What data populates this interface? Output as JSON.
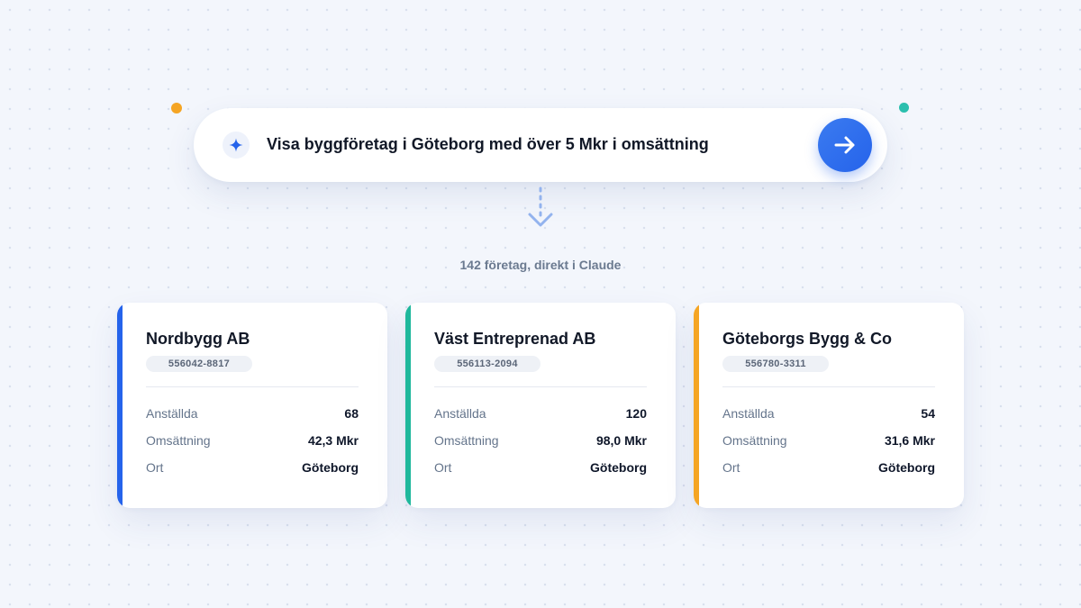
{
  "search": {
    "query": "Visa byggföretag i Göteborg med över 5 Mkr i omsättning",
    "sparkle_icon": "sparkle-icon",
    "submit_icon": "arrow-right-icon"
  },
  "result_summary": "142 företag, direkt i Claude",
  "labels": {
    "employees": "Anställda",
    "revenue": "Omsättning",
    "city": "Ort"
  },
  "companies": [
    {
      "name": "Nordbygg AB",
      "org_number": "556042-8817",
      "employees": "68",
      "revenue": "42,3 Mkr",
      "city": "Göteborg",
      "accent": "#2563eb"
    },
    {
      "name": "Väst Entreprenad AB",
      "org_number": "556113-2094",
      "employees": "120",
      "revenue": "98,0 Mkr",
      "city": "Göteborg",
      "accent": "#1fb89c"
    },
    {
      "name": "Göteborgs Bygg & Co",
      "org_number": "556780-3311",
      "employees": "54",
      "revenue": "31,6 Mkr",
      "city": "Göteborg",
      "accent": "#f5a524"
    }
  ],
  "colors": {
    "primary": "#2563eb",
    "background": "#f3f6fc",
    "decor_orange": "#f5a524",
    "decor_teal": "#2bbfae"
  }
}
